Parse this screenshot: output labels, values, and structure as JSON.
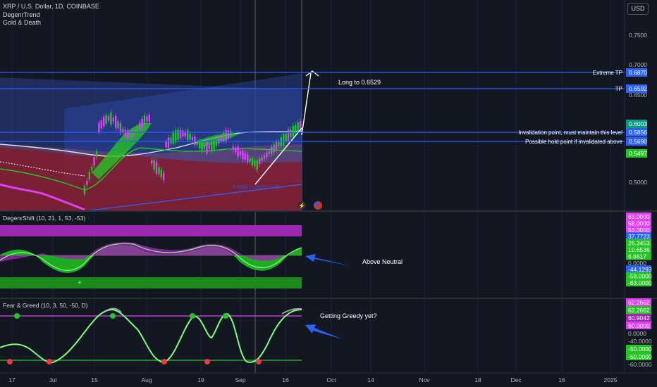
{
  "header": {
    "symbol_line": "XRP / U.S. Dollar, 1D, COINBASE",
    "indicator1": "DegenrTrend",
    "indicator2": "Gold & Death",
    "currency_button": "USD"
  },
  "colors": {
    "background": "#131722",
    "blue_line": "#2962ff",
    "green": "#22c522",
    "magenta": "#e040fb",
    "purple": "#9c27b0",
    "red_band": "#8b1e2e"
  },
  "main_pane": {
    "price_ticks": [
      "0.7500",
      "0.7000",
      "0.6500",
      "0.5000"
    ],
    "price_labels": [
      {
        "text": "0.6870",
        "color": "#2962ff"
      },
      {
        "text": "0.6592",
        "color": "#2962ff"
      },
      {
        "text": "0.6003",
        "color": "#089981"
      },
      {
        "text": "0.5856",
        "color": "#2962ff"
      },
      {
        "text": "0.5690",
        "color": "#2962ff"
      },
      {
        "text": "0.5497",
        "color": "#22c522"
      }
    ],
    "line_notes": [
      "Extreme TP",
      "TP",
      "Invalidation point, must maintain this level",
      "Possible hold point if invalidated above"
    ],
    "callout": "Long to 0.6529",
    "faint_label": "0.5066 (-0.05%) 0.50"
  },
  "degenrshift": {
    "title": "DegenrShift (10, 21, 1, 53, -53)",
    "scale_labels": [
      {
        "text": "63.0000",
        "color": "#e040fb"
      },
      {
        "text": "58.0000",
        "color": "#e040fb"
      },
      {
        "text": "53.0000",
        "color": "#e040fb"
      },
      {
        "text": "37.7723",
        "color": "#2962ff"
      },
      {
        "text": "26.3453",
        "color": "#22c522"
      },
      {
        "text": "19.6536",
        "color": "#22c522"
      },
      {
        "text": "6.6617",
        "color": "#22c522"
      },
      {
        "text": "0.0000",
        "color": "none"
      },
      {
        "text": "-44.1293",
        "color": "#2962ff"
      },
      {
        "text": "-58.0000",
        "color": "#22c522"
      },
      {
        "text": "-63.0000",
        "color": "#22c522"
      }
    ],
    "note": "Above Neutral"
  },
  "fear_greed": {
    "title": "Fear & Greed (10, 3, 50, -50, D)",
    "scale_labels": [
      {
        "text": "62.2662",
        "color": "#e040fb"
      },
      {
        "text": "62.2662",
        "color": "#22c522"
      },
      {
        "text": "60.9042",
        "color": "#9c27b0"
      },
      {
        "text": "50.0000",
        "color": "#e040fb"
      },
      {
        "text": "0.0000",
        "color": "none"
      },
      {
        "text": "-40.0000",
        "color": "none"
      },
      {
        "text": "-50.0000",
        "color": "#22c522"
      },
      {
        "text": "-50.0000",
        "color": "#22c522"
      },
      {
        "text": "-60.0000",
        "color": "none"
      }
    ],
    "note": "Getting Greedy yet?"
  },
  "time_axis": [
    "17",
    "Jul",
    "15",
    "Aug",
    "19",
    "Sep",
    "16",
    "Oct",
    "14",
    "Nov",
    "18",
    "Dec",
    "16",
    "2025"
  ],
  "chart_data": {
    "type": "line",
    "title": "XRP / U.S. Dollar, 1D, COINBASE",
    "y_ticks": [
      0.75,
      0.7,
      0.65,
      0.5
    ],
    "horizontal_levels": [
      {
        "name": "Extreme TP",
        "value": 0.687
      },
      {
        "name": "TP",
        "value": 0.6592
      },
      {
        "name": "Invalidation point, must maintain this level",
        "value": 0.5856
      },
      {
        "name": "Possible hold point if invalidated above",
        "value": 0.569
      }
    ],
    "current_price": 0.6003,
    "green_ma": 0.5497,
    "target": 0.6529,
    "ylim": [
      0.46,
      0.78
    ],
    "x_labels": [
      "17",
      "Jul",
      "15",
      "Aug",
      "19",
      "Sep",
      "16",
      "Oct",
      "14",
      "Nov",
      "18",
      "Dec",
      "16",
      "2025"
    ],
    "grid": true
  }
}
